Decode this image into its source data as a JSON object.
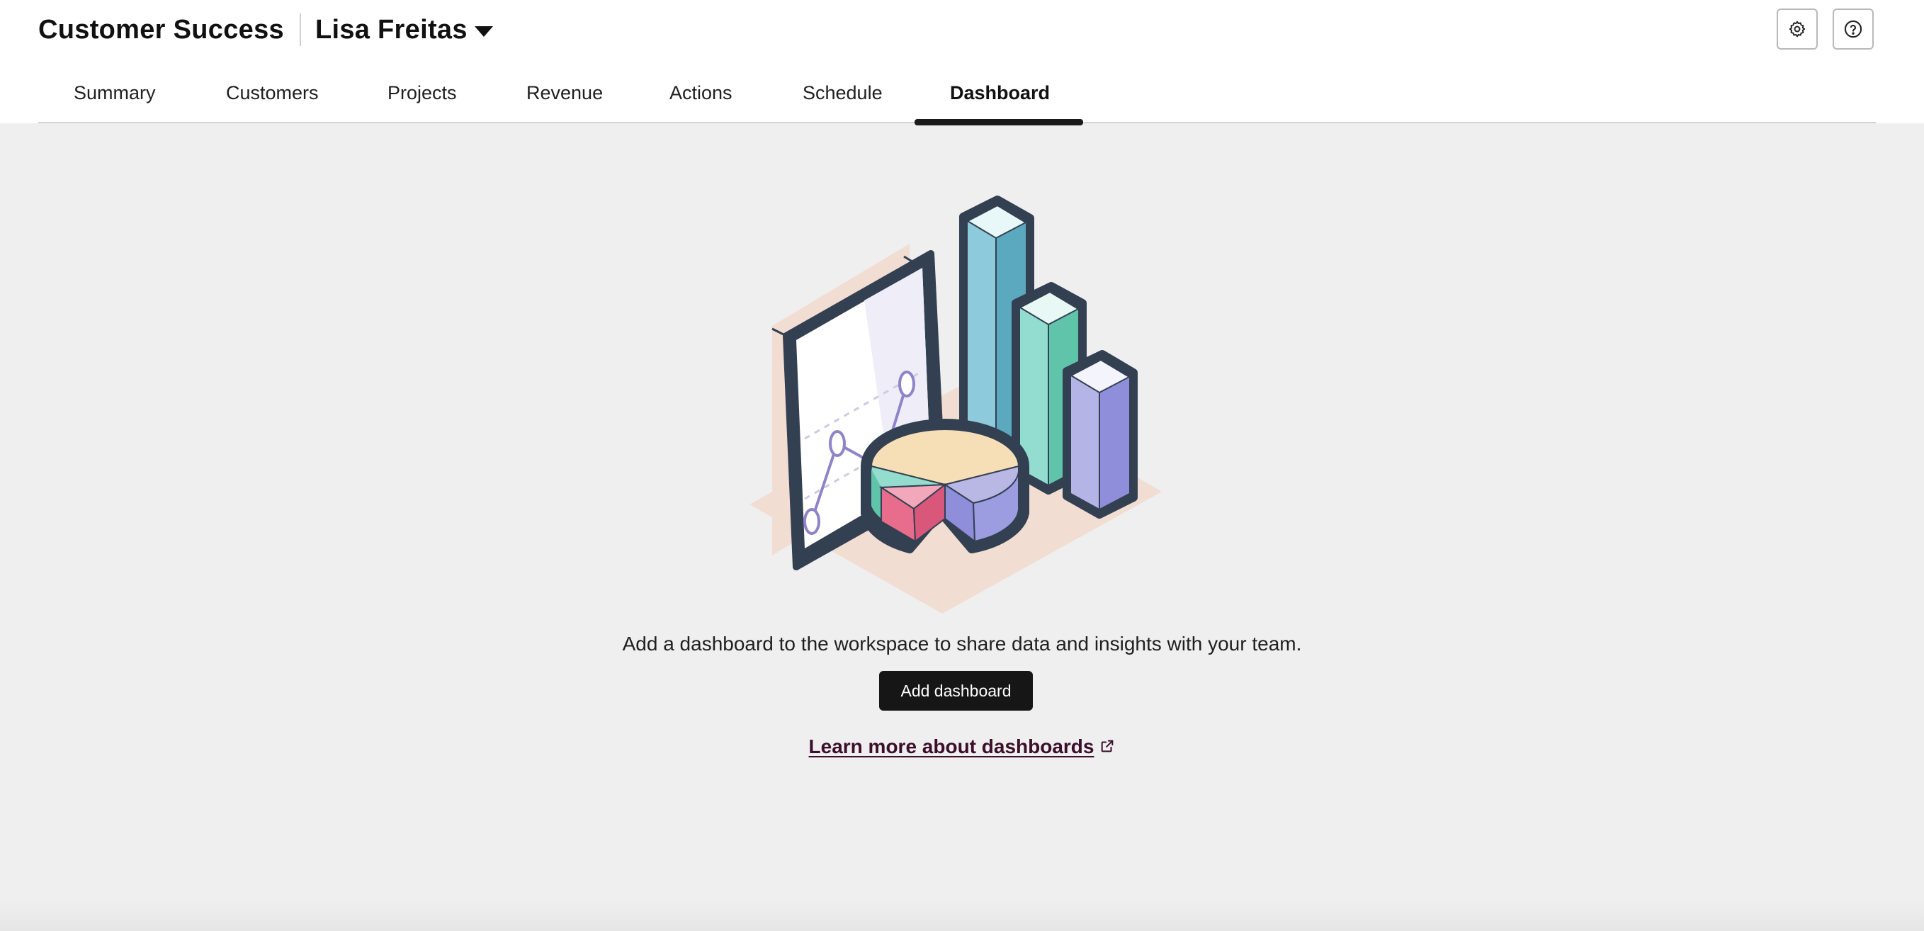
{
  "header": {
    "app_title": "Customer Success",
    "owner_name": "Lisa Freitas",
    "settings_icon": "gear-icon",
    "help_icon": "question-circle-icon"
  },
  "tabs": [
    {
      "label": "Summary",
      "active": false
    },
    {
      "label": "Customers",
      "active": false
    },
    {
      "label": "Projects",
      "active": false
    },
    {
      "label": "Revenue",
      "active": false
    },
    {
      "label": "Actions",
      "active": false
    },
    {
      "label": "Schedule",
      "active": false
    },
    {
      "label": "Dashboard",
      "active": true
    }
  ],
  "empty_state": {
    "message": "Add a dashboard to the workspace to share data and insights with your team.",
    "button_label": "Add dashboard",
    "link_text": "Learn more about dashboards",
    "link_icon": "external-link-icon"
  },
  "colors": {
    "primary_button": "#161616",
    "link": "#3b0f2a",
    "page_background": "#efefef"
  }
}
